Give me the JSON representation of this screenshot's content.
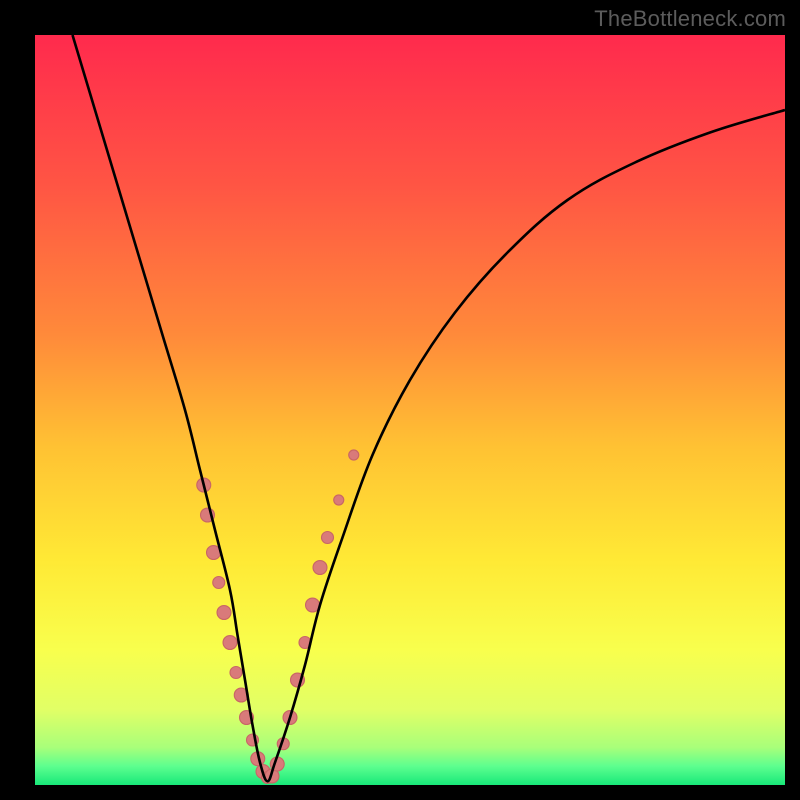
{
  "watermark": "TheBottleneck.com",
  "colors": {
    "frame": "#000000",
    "gradient_stops": [
      {
        "offset": 0.0,
        "color": "#ff2a4d"
      },
      {
        "offset": 0.2,
        "color": "#ff5544"
      },
      {
        "offset": 0.4,
        "color": "#ff8a3a"
      },
      {
        "offset": 0.55,
        "color": "#ffc233"
      },
      {
        "offset": 0.7,
        "color": "#ffe935"
      },
      {
        "offset": 0.82,
        "color": "#f8ff4d"
      },
      {
        "offset": 0.9,
        "color": "#e1ff66"
      },
      {
        "offset": 0.95,
        "color": "#a8ff7a"
      },
      {
        "offset": 0.975,
        "color": "#5dff8f"
      },
      {
        "offset": 1.0,
        "color": "#18e879"
      }
    ],
    "curve": "#000000",
    "marker_fill": "#d97a7a",
    "marker_stroke": "#c86666"
  },
  "chart_data": {
    "type": "line",
    "title": "",
    "xlabel": "",
    "ylabel": "",
    "xlim": [
      0,
      100
    ],
    "ylim": [
      0,
      100
    ],
    "series": [
      {
        "name": "bottleneck-curve",
        "x": [
          5,
          8,
          11,
          14,
          17,
          20,
          22,
          24,
          26,
          27,
          28,
          29,
          30,
          31,
          32,
          34,
          36,
          38,
          41,
          45,
          50,
          56,
          63,
          71,
          80,
          90,
          100
        ],
        "y": [
          100,
          90,
          80,
          70,
          60,
          50,
          42,
          34,
          26,
          20,
          14,
          8,
          3,
          0.5,
          3,
          9,
          16,
          24,
          33,
          44,
          54,
          63,
          71,
          78,
          83,
          87,
          90
        ]
      }
    ],
    "markers": [
      {
        "x": 22.5,
        "y": 40,
        "r": 7
      },
      {
        "x": 23.0,
        "y": 36,
        "r": 7
      },
      {
        "x": 23.8,
        "y": 31,
        "r": 7
      },
      {
        "x": 24.5,
        "y": 27,
        "r": 6
      },
      {
        "x": 25.2,
        "y": 23,
        "r": 7
      },
      {
        "x": 26.0,
        "y": 19,
        "r": 7
      },
      {
        "x": 26.8,
        "y": 15,
        "r": 6
      },
      {
        "x": 27.5,
        "y": 12,
        "r": 7
      },
      {
        "x": 28.2,
        "y": 9,
        "r": 7
      },
      {
        "x": 29.0,
        "y": 6,
        "r": 6
      },
      {
        "x": 29.7,
        "y": 3.5,
        "r": 7
      },
      {
        "x": 30.4,
        "y": 1.8,
        "r": 7
      },
      {
        "x": 31.0,
        "y": 1.0,
        "r": 6
      },
      {
        "x": 31.6,
        "y": 1.2,
        "r": 7
      },
      {
        "x": 32.3,
        "y": 2.8,
        "r": 7
      },
      {
        "x": 33.1,
        "y": 5.5,
        "r": 6
      },
      {
        "x": 34.0,
        "y": 9,
        "r": 7
      },
      {
        "x": 35.0,
        "y": 14,
        "r": 7
      },
      {
        "x": 36.0,
        "y": 19,
        "r": 6
      },
      {
        "x": 37.0,
        "y": 24,
        "r": 7
      },
      {
        "x": 38.0,
        "y": 29,
        "r": 7
      },
      {
        "x": 39.0,
        "y": 33,
        "r": 6
      },
      {
        "x": 40.5,
        "y": 38,
        "r": 5
      },
      {
        "x": 42.5,
        "y": 44,
        "r": 5
      }
    ]
  }
}
